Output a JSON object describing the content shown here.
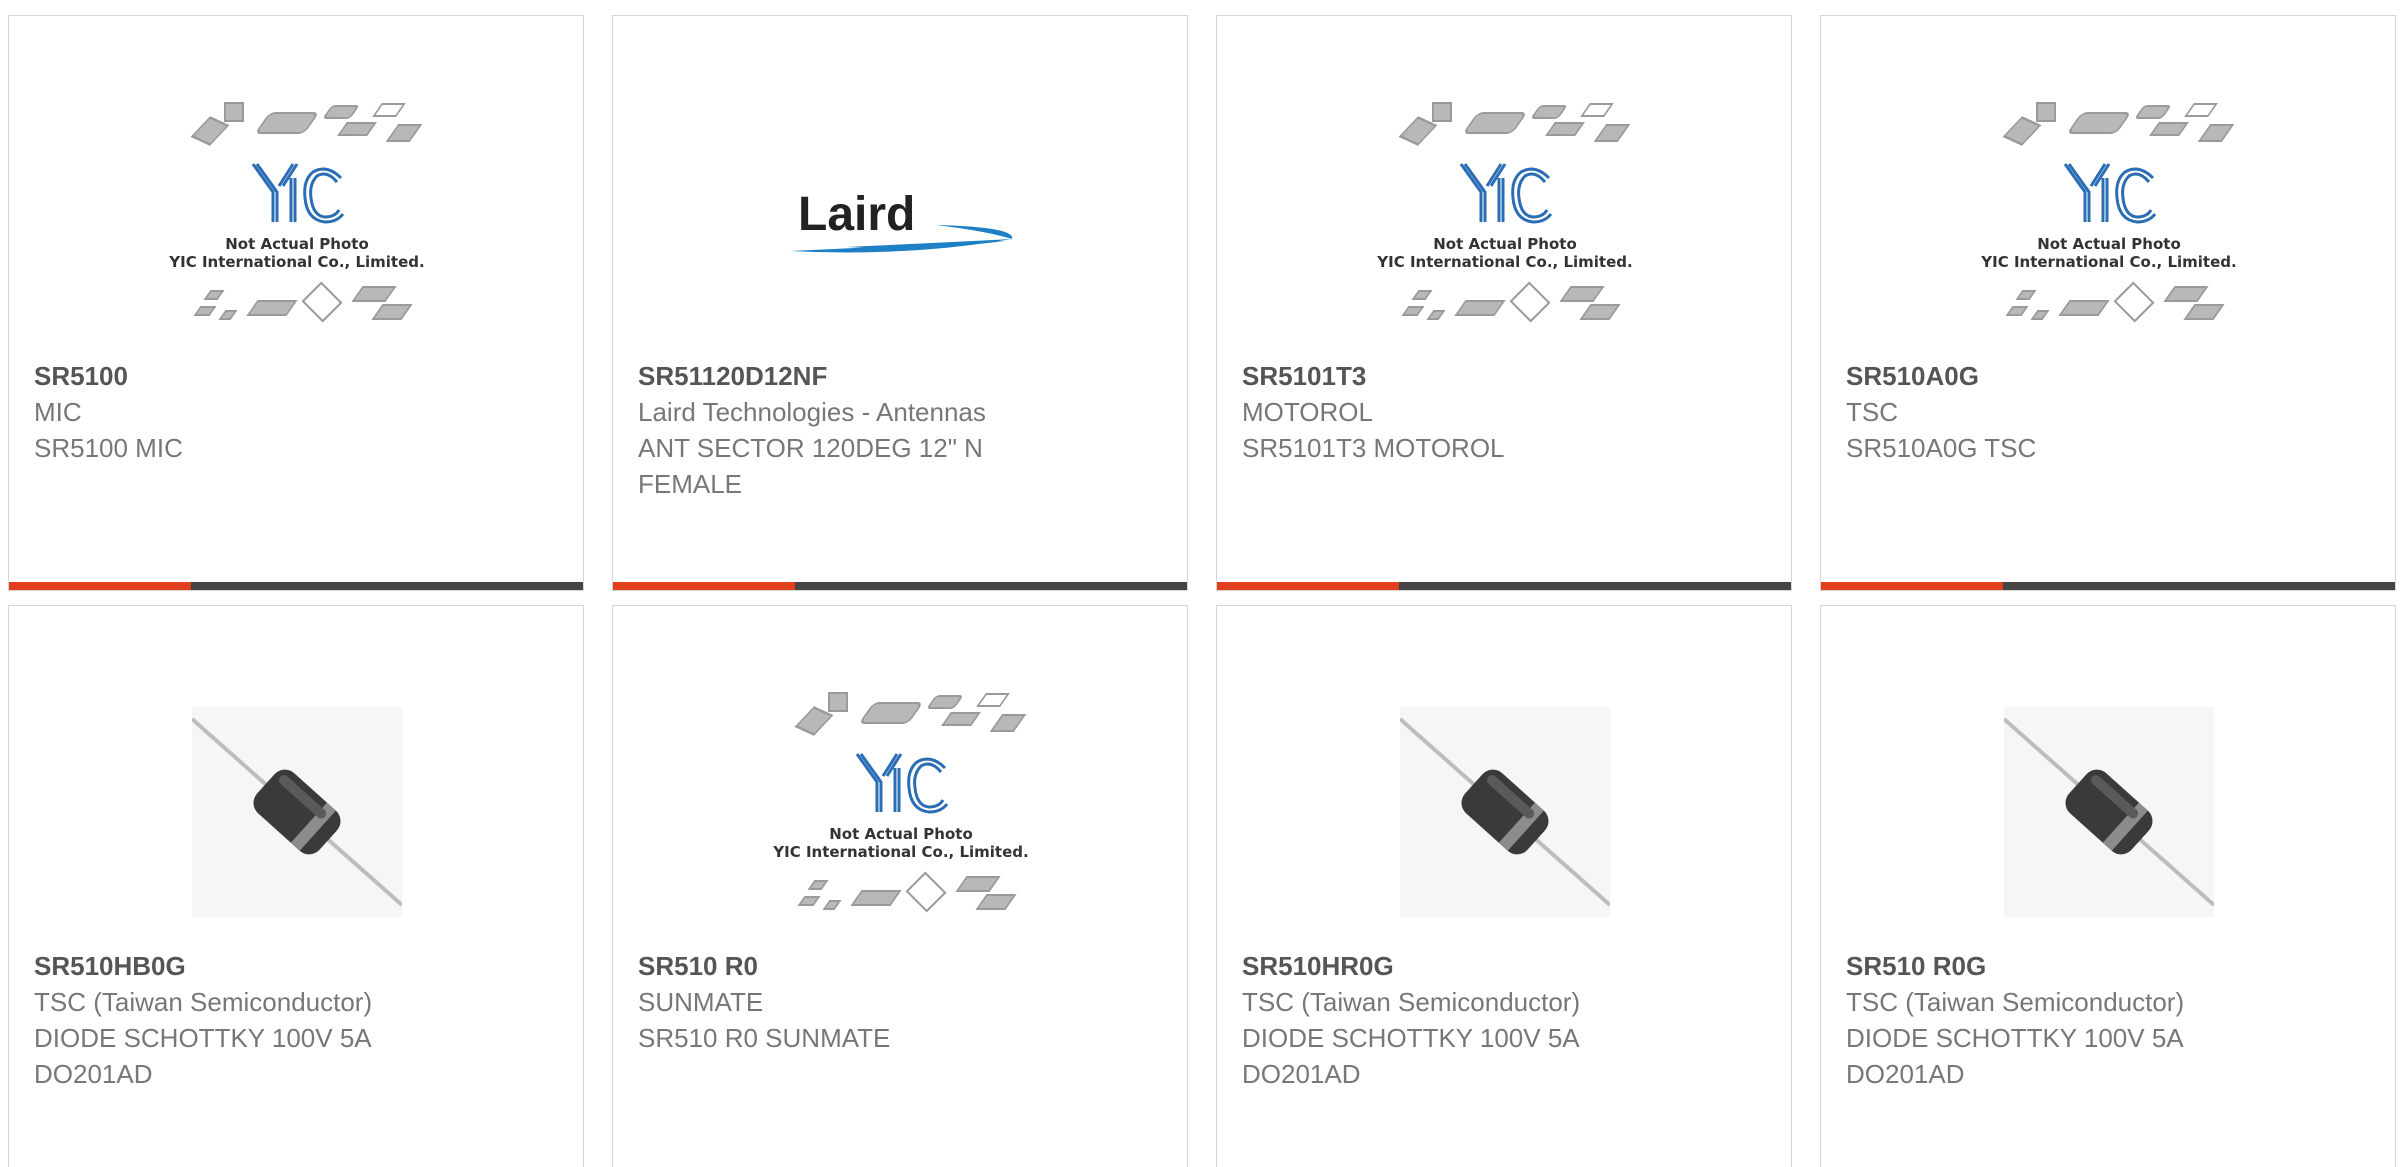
{
  "products": [
    {
      "part": "SR5100",
      "lines": [
        "MIC",
        "SR5100 MIC"
      ],
      "image": "placeholder-not-actual-photo"
    },
    {
      "part": "SR51120D12NF",
      "lines": [
        "Laird Technologies - Antennas",
        "ANT SECTOR 120DEG 12\" N",
        "FEMALE"
      ],
      "image": "laird-logo"
    },
    {
      "part": "SR5101T3",
      "lines": [
        "MOTOROL",
        "SR5101T3 MOTOROL"
      ],
      "image": "placeholder-not-actual-photo"
    },
    {
      "part": "SR510A0G",
      "lines": [
        "TSC",
        "SR510A0G TSC"
      ],
      "image": "placeholder-not-actual-photo"
    },
    {
      "part": "SR510HB0G",
      "lines": [
        "TSC (Taiwan Semiconductor)",
        "DIODE SCHOTTKY 100V 5A",
        "DO201AD"
      ],
      "image": "diode-photo"
    },
    {
      "part": "SR510 R0",
      "lines": [
        "SUNMATE",
        "SR510 R0 SUNMATE"
      ],
      "image": "placeholder-not-actual-photo"
    },
    {
      "part": "SR510HR0G",
      "lines": [
        "TSC (Taiwan Semiconductor)",
        "DIODE SCHOTTKY 100V 5A",
        "DO201AD"
      ],
      "image": "diode-photo"
    },
    {
      "part": "SR510 R0G",
      "lines": [
        "TSC (Taiwan Semiconductor)",
        "DIODE SCHOTTKY 100V 5A",
        "DO201AD"
      ],
      "image": "diode-photo"
    }
  ],
  "placeholder": {
    "logo_text": "YIC",
    "caption_1": "Not Actual Photo",
    "caption_2": "YIC International Co., Limited."
  },
  "laird_logo_text": "Laird",
  "colors": {
    "accent": "#e2401c",
    "bar": "#444444",
    "part_text": "#555555",
    "detail_text": "#777777",
    "yic_blue": "#2a6db5",
    "laird_blue": "#1f7fc4"
  }
}
